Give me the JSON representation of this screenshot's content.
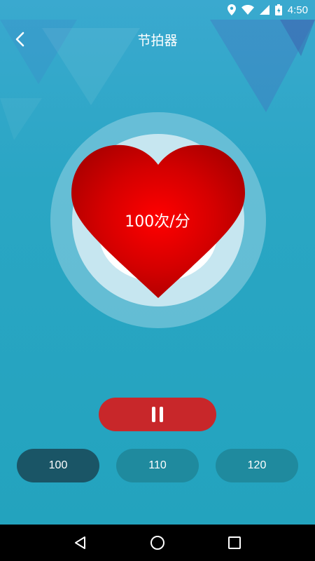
{
  "status_bar": {
    "time": "4:50",
    "icons": [
      "location-icon",
      "wifi-icon",
      "signal-icon",
      "battery-icon"
    ]
  },
  "app_bar": {
    "title": "节拍器",
    "back_icon": "chevron-left-icon"
  },
  "metronome": {
    "bpm_label": "100次/分",
    "heart_color": "#e00000"
  },
  "controls": {
    "pause_icon": "pause-icon",
    "pause_color": "#c8272a"
  },
  "presets": [
    {
      "label": "100",
      "selected": true
    },
    {
      "label": "110",
      "selected": false
    },
    {
      "label": "120",
      "selected": false
    }
  ],
  "nav_bar": {
    "icons": [
      "back-triangle-icon",
      "home-circle-icon",
      "recents-square-icon"
    ]
  },
  "colors": {
    "background": "#2aa6c4",
    "preset_active": "#1a5566",
    "preset_inactive": "#1f8a9e"
  }
}
